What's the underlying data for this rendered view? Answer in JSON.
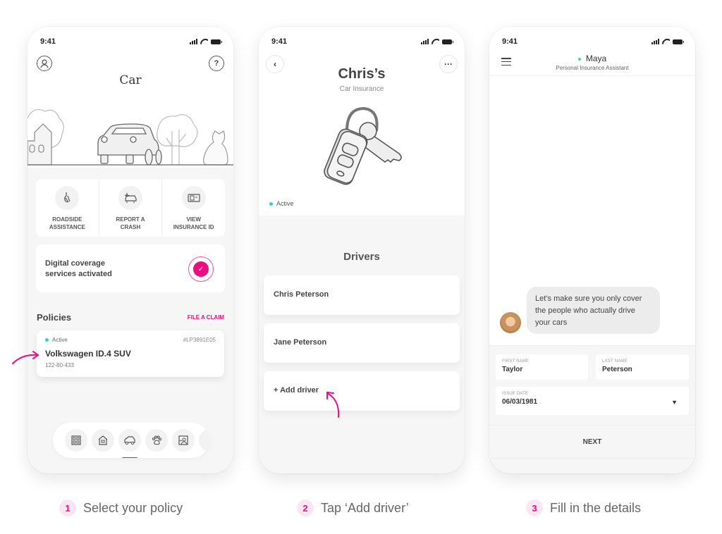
{
  "colors": {
    "accent": "#ec0e7f",
    "active_dot": "#2dd4bf",
    "online_dot": "#4ade80"
  },
  "status_bar": {
    "time": "9:41"
  },
  "screen1": {
    "profile_icon": "user-circle-icon",
    "help_icon": "question-bubble-icon",
    "title": "Car",
    "actions": [
      {
        "icon": "tow-hook-icon",
        "label_line1": "ROADSIDE",
        "label_line2": "ASSISTANCE"
      },
      {
        "icon": "car-crash-icon",
        "label_line1": "REPORT A",
        "label_line2": "CRASH"
      },
      {
        "icon": "id-card-icon",
        "label_line1": "VIEW",
        "label_line2": "INSURANCE ID"
      }
    ],
    "coverage": {
      "line1": "Digital coverage",
      "line2": "services activated",
      "icon": "check-icon"
    },
    "policies_title": "Policies",
    "file_claim": "FILE A CLAIM",
    "policy": {
      "status": "Active",
      "number": "#LP3891E05",
      "name": "Volkswagen ID.4 SUV",
      "plate": "122-80-433"
    },
    "nav": [
      {
        "icon": "building-icon",
        "active": false
      },
      {
        "icon": "home-icon",
        "active": false
      },
      {
        "icon": "car-icon",
        "active": true
      },
      {
        "icon": "paw-icon",
        "active": false
      },
      {
        "icon": "portrait-icon",
        "active": false
      }
    ]
  },
  "screen2": {
    "back_icon": "chevron-left-icon",
    "more_icon": "more-horizontal-icon",
    "title": "Chris’s",
    "subtitle": "Car Insurance",
    "status": "Active",
    "drivers_title": "Drivers",
    "drivers": [
      "Chris Peterson",
      "Jane Peterson"
    ],
    "add_driver": "+ Add driver"
  },
  "screen3": {
    "menu_icon": "hamburger-menu-icon",
    "assistant_name": "Maya",
    "assistant_role": "Personal Insurance Assistant",
    "message": "Let’s make sure you only cover the people who actually drive your cars",
    "fields": {
      "first_name": {
        "label": "FIRST NAME",
        "value": "Taylor"
      },
      "last_name": {
        "label": "LAST NAME",
        "value": "Peterson"
      },
      "issue_date": {
        "label": "ISSUE DATE",
        "value": "06/03/1981"
      }
    },
    "next_label": "NEXT"
  },
  "captions": [
    {
      "number": "1",
      "text": "Select your policy"
    },
    {
      "number": "2",
      "text": "Tap ‘Add driver’"
    },
    {
      "number": "3",
      "text": "Fill in the details"
    }
  ]
}
